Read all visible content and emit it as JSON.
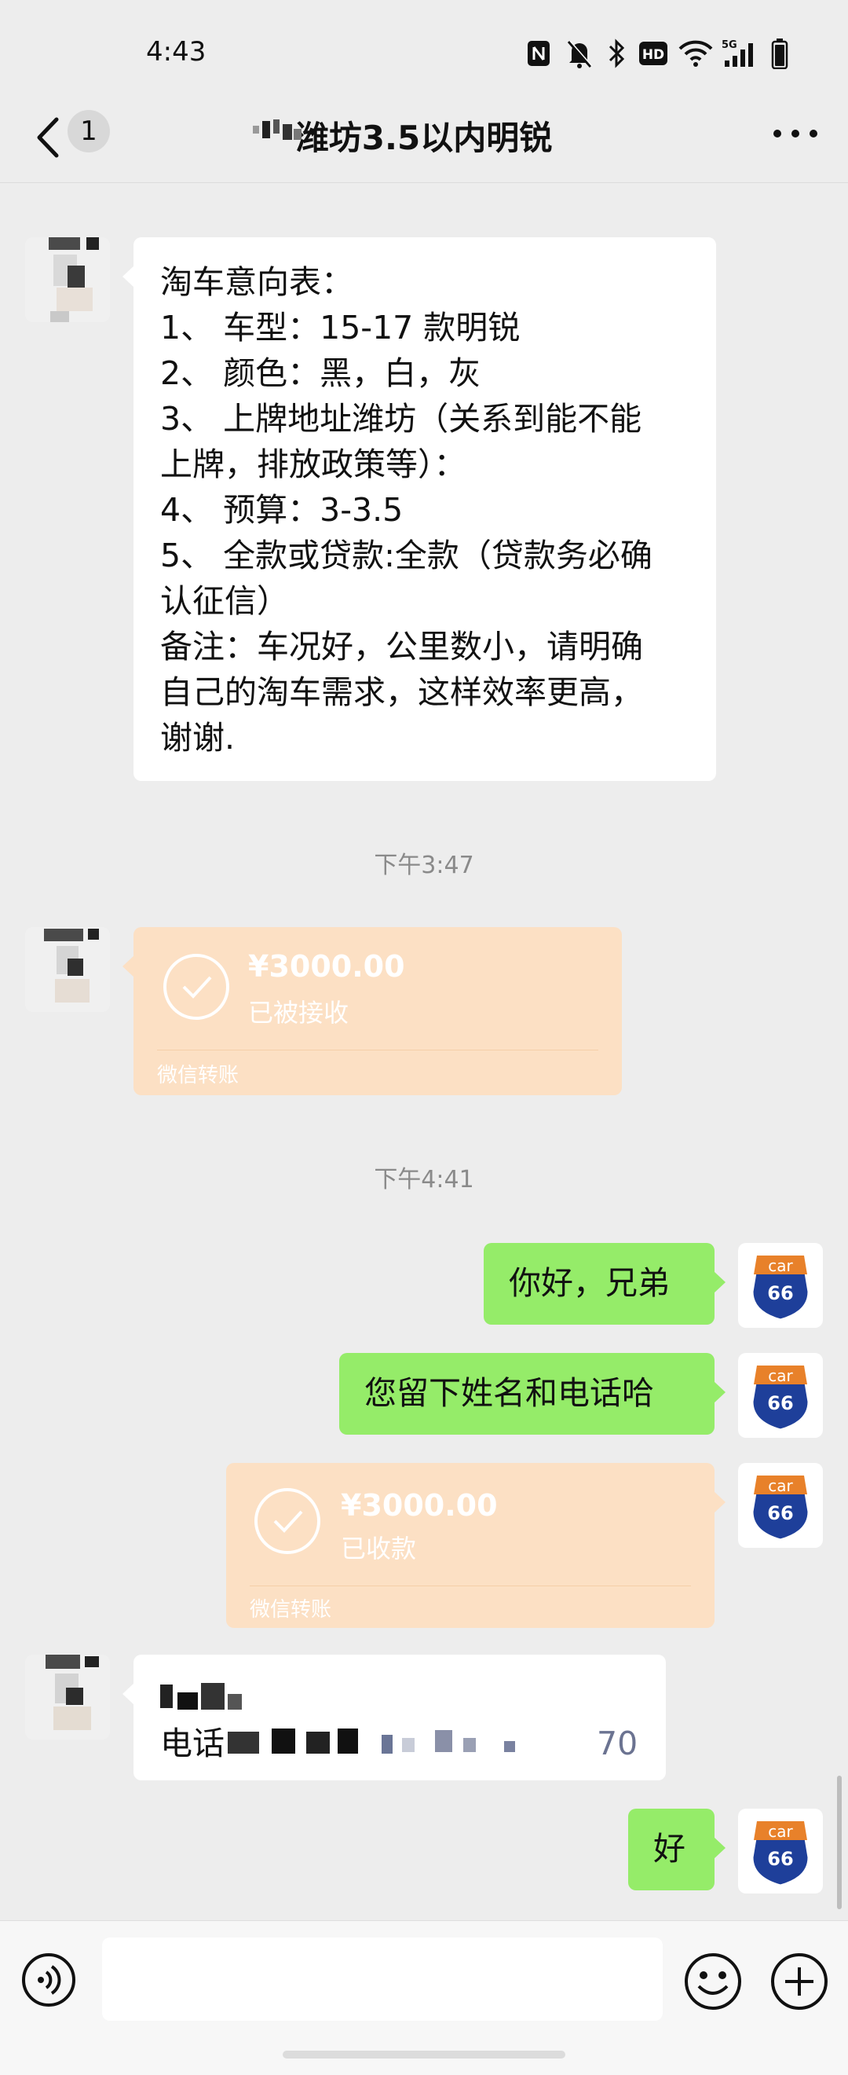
{
  "status_bar": {
    "time": "4:43",
    "icons": [
      "nfc-icon",
      "mute-icon",
      "bluetooth-icon",
      "hd-icon",
      "wifi-icon",
      "5g-signal-icon",
      "battery-icon"
    ]
  },
  "nav": {
    "back_icon": "chevron-left-icon",
    "unread_count": "1",
    "title": "潍坊3.5以内明锐",
    "more_icon": "more-icon"
  },
  "messages": {
    "intent_form": {
      "lines": [
        "淘车意向表：",
        "1、 车型：15-17 款明锐",
        "2、 颜色：黑，白，灰",
        "3、 上牌地址潍坊（关系到能不能",
        "上牌，排放政策等）：",
        "4、 预算：3-3.5",
        "5、 全款或贷款:全款（贷款务必确",
        "认征信）",
        "备注：车况好，公里数小，请明确",
        "自己的淘车需求，这样效率更高，",
        "谢谢."
      ]
    },
    "time_1": "下午3:47",
    "transfer_1": {
      "amount": "¥3000.00",
      "status": "已被接收",
      "footer": "微信转账"
    },
    "time_2": "下午4:41",
    "sent_1": "你好，兄弟",
    "sent_2": "您留下姓名和电话哈",
    "transfer_2": {
      "amount": "¥3000.00",
      "status": "已收款",
      "footer": "微信转账"
    },
    "contact_reply": {
      "line_2_prefix": "电话",
      "line_2_suffix": "70"
    },
    "sent_3": "好"
  },
  "self_avatar": {
    "top": "car",
    "number": "66"
  },
  "colors": {
    "background": "#ededed",
    "bubble_green": "#95ec69",
    "bubble_white": "#ffffff",
    "transfer_orange": "#fce0c4",
    "timestamp_gray": "#8a8a8a"
  },
  "input_bar": {
    "voice_icon": "voice-icon",
    "emoji_icon": "emoji-icon",
    "plus_icon": "plus-icon",
    "placeholder": ""
  }
}
